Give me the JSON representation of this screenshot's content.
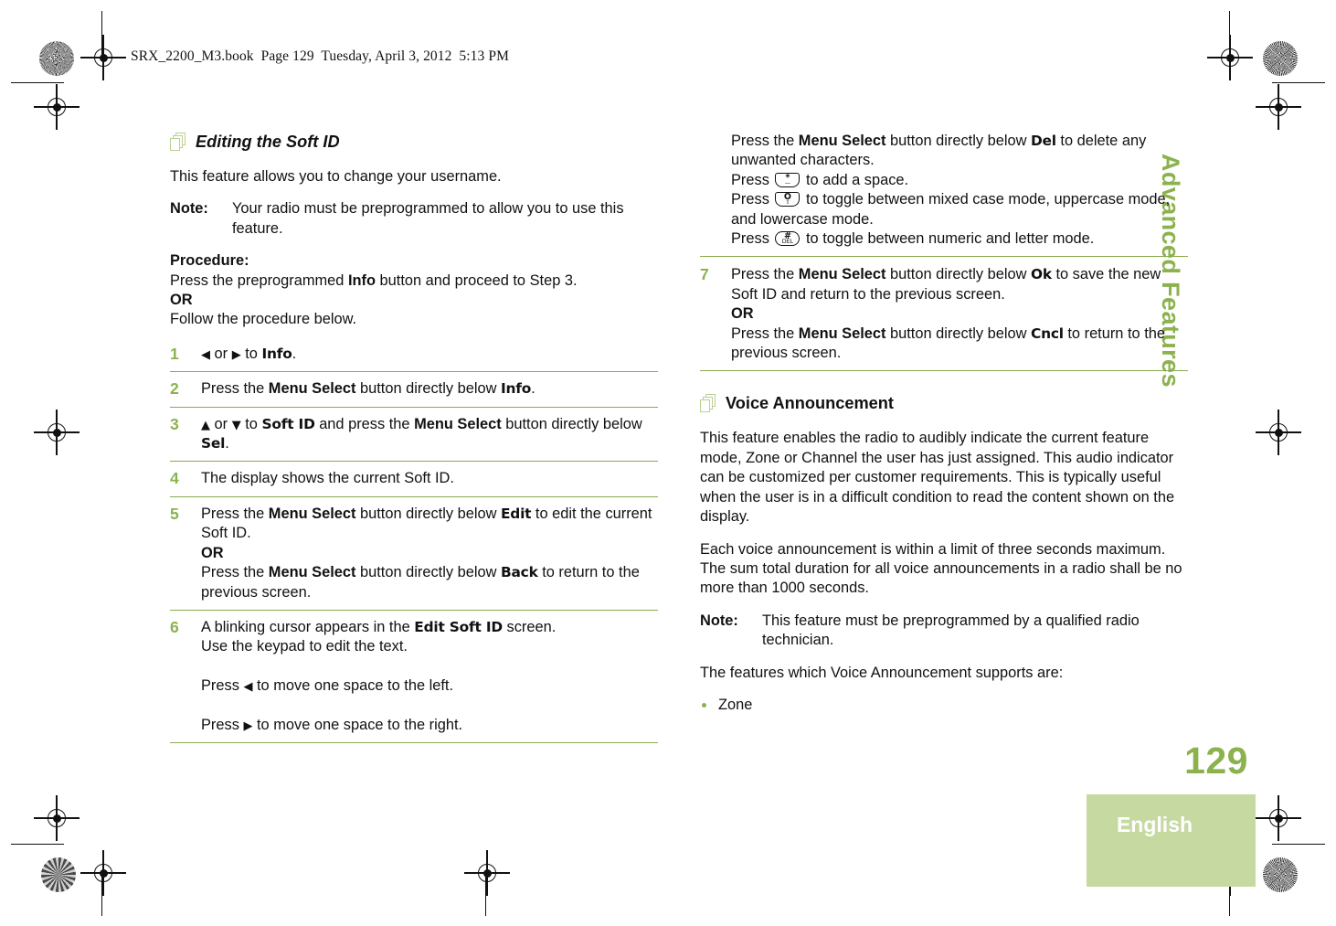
{
  "header": {
    "book_line": "SRX_2200_M3.book  Page 129  Tuesday, April 3, 2012  5:13 PM"
  },
  "sidebar": {
    "chapter_title": "Advanced Features",
    "page_number": "129",
    "language_tab": "English"
  },
  "colors": {
    "accent_green": "#8cb24e",
    "rule_green": "#87ab4d",
    "tab_green": "#c6d9a0",
    "icon_green": "#b9d18f"
  },
  "left_column": {
    "heading": "Editing the Soft ID",
    "intro": "This feature allows you to change your username.",
    "note": {
      "label": "Note:",
      "text": "Your radio must be preprogrammed to allow you to use this feature."
    },
    "procedure_label": "Procedure:",
    "procedure_line1_a": "Press the preprogrammed ",
    "procedure_line1_b": "Info",
    "procedure_line1_c": " button and proceed to Step 3.",
    "or": "OR",
    "procedure_line2": "Follow the procedure below.",
    "steps": [
      {
        "num": "1",
        "parts": [
          {
            "t": "arrow-left",
            "v": "◀"
          },
          {
            "t": "plain",
            "v": " or "
          },
          {
            "t": "arrow-right",
            "v": "▶"
          },
          {
            "t": "plain",
            "v": " to "
          },
          {
            "t": "lcd",
            "v": "Info"
          },
          {
            "t": "plain",
            "v": "."
          }
        ]
      },
      {
        "num": "2",
        "parts": [
          {
            "t": "plain",
            "v": "Press the "
          },
          {
            "t": "bold",
            "v": "Menu Select"
          },
          {
            "t": "plain",
            "v": " button directly below "
          },
          {
            "t": "lcd",
            "v": "Info"
          },
          {
            "t": "plain",
            "v": "."
          }
        ]
      },
      {
        "num": "3",
        "parts": [
          {
            "t": "arrow-up",
            "v": "▲"
          },
          {
            "t": "plain",
            "v": " or "
          },
          {
            "t": "arrow-down",
            "v": "▼"
          },
          {
            "t": "plain",
            "v": " to "
          },
          {
            "t": "lcd",
            "v": "Soft ID"
          },
          {
            "t": "plain",
            "v": " and press the "
          },
          {
            "t": "bold",
            "v": "Menu Select"
          },
          {
            "t": "plain",
            "v": " button directly below "
          },
          {
            "t": "lcd",
            "v": "Sel"
          },
          {
            "t": "plain",
            "v": "."
          }
        ]
      },
      {
        "num": "4",
        "parts": [
          {
            "t": "plain",
            "v": "The display shows the current Soft ID."
          }
        ]
      },
      {
        "num": "5",
        "parts": [
          {
            "t": "plain",
            "v": "Press the "
          },
          {
            "t": "bold",
            "v": "Menu Select"
          },
          {
            "t": "plain",
            "v": " button directly below "
          },
          {
            "t": "lcd",
            "v": "Edit"
          },
          {
            "t": "plain",
            "v": " to edit the current Soft ID."
          },
          {
            "t": "br",
            "v": ""
          },
          {
            "t": "bold",
            "v": "OR"
          },
          {
            "t": "br",
            "v": ""
          },
          {
            "t": "plain",
            "v": "Press the "
          },
          {
            "t": "bold",
            "v": "Menu Select"
          },
          {
            "t": "plain",
            "v": " button directly below "
          },
          {
            "t": "lcd",
            "v": "Back"
          },
          {
            "t": "plain",
            "v": " to return to the previous screen."
          }
        ]
      },
      {
        "num": "6",
        "parts": [
          {
            "t": "plain",
            "v": "A blinking cursor appears in the "
          },
          {
            "t": "lcd",
            "v": "Edit Soft ID"
          },
          {
            "t": "plain",
            "v": " screen."
          },
          {
            "t": "br",
            "v": ""
          },
          {
            "t": "plain",
            "v": "Use the keypad to edit the text."
          },
          {
            "t": "brgap",
            "v": ""
          },
          {
            "t": "plain",
            "v": "Press "
          },
          {
            "t": "arrow-left",
            "v": "◀"
          },
          {
            "t": "plain",
            "v": " to move one space to the left."
          },
          {
            "t": "brgap",
            "v": ""
          },
          {
            "t": "plain",
            "v": "Press "
          },
          {
            "t": "arrow-right",
            "v": "▶"
          },
          {
            "t": "plain",
            "v": " to move one space to the right."
          }
        ]
      }
    ]
  },
  "right_column": {
    "step6_continued": [
      {
        "t": "plain",
        "v": "Press the "
      },
      {
        "t": "bold",
        "v": "Menu Select"
      },
      {
        "t": "plain",
        "v": " button directly below "
      },
      {
        "t": "lcd",
        "v": "Del"
      },
      {
        "t": "plain",
        "v": " to delete any unwanted characters."
      },
      {
        "t": "br",
        "v": ""
      },
      {
        "t": "plain",
        "v": "Press "
      },
      {
        "t": "key",
        "v": "star-key"
      },
      {
        "t": "plain",
        "v": " to add a space."
      },
      {
        "t": "br",
        "v": ""
      },
      {
        "t": "plain",
        "v": "Press "
      },
      {
        "t": "key",
        "v": "zero-shift-key"
      },
      {
        "t": "plain",
        "v": " to toggle between mixed case mode, uppercase mode, and lowercase mode."
      },
      {
        "t": "br",
        "v": ""
      },
      {
        "t": "plain",
        "v": "Press "
      },
      {
        "t": "key",
        "v": "hash-del-key"
      },
      {
        "t": "plain",
        "v": " to toggle between numeric and letter mode."
      }
    ],
    "keys": {
      "star_key": {
        "top": "*",
        "bottom": "—"
      },
      "zero_shift_key": {
        "top": "O",
        "bottom": "⇧"
      },
      "hash_del_key": {
        "top": "#",
        "bottom": "DEL"
      }
    },
    "step7": {
      "num": "7",
      "parts": [
        {
          "t": "plain",
          "v": "Press the "
        },
        {
          "t": "bold",
          "v": "Menu Select"
        },
        {
          "t": "plain",
          "v": " button directly below "
        },
        {
          "t": "lcd",
          "v": "Ok"
        },
        {
          "t": "plain",
          "v": " to save the new Soft ID and return to the previous screen."
        },
        {
          "t": "br",
          "v": ""
        },
        {
          "t": "bold",
          "v": "OR"
        },
        {
          "t": "br",
          "v": ""
        },
        {
          "t": "plain",
          "v": "Press the "
        },
        {
          "t": "bold",
          "v": "Menu Select"
        },
        {
          "t": "plain",
          "v": " button directly below "
        },
        {
          "t": "lcd",
          "v": "Cncl"
        },
        {
          "t": "plain",
          "v": " to return to the previous screen."
        }
      ]
    },
    "heading": "Voice Announcement",
    "para1": "This feature enables the radio to audibly indicate the current feature mode, Zone or Channel the user has just assigned. This audio indicator can be customized per customer requirements. This is typically useful when the user is in a difficult condition to read the content shown on the display.",
    "para2": "Each voice announcement is within a limit of three seconds maximum. The sum total duration for all voice announcements in a radio shall be no more than 1000 seconds.",
    "note": {
      "label": "Note:",
      "text": "This feature must be preprogrammed by a qualified radio technician."
    },
    "para3": "The features which Voice Announcement supports are:",
    "bullets": [
      "Zone"
    ]
  }
}
